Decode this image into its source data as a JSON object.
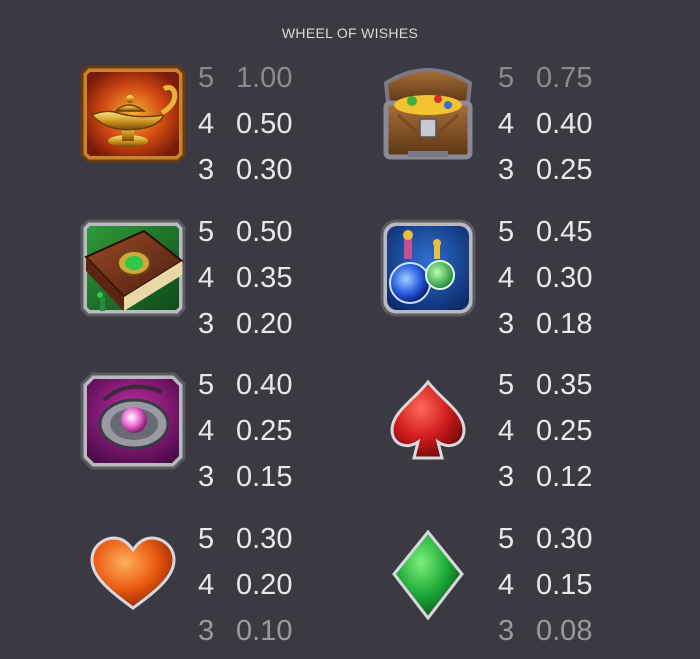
{
  "title": "WHEEL OF WISHES",
  "symbols": [
    {
      "name": "lamp-icon",
      "pays": [
        {
          "count": "5",
          "value": "1.00"
        },
        {
          "count": "4",
          "value": "0.50"
        },
        {
          "count": "3",
          "value": "0.30"
        }
      ]
    },
    {
      "name": "treasure-chest-icon",
      "pays": [
        {
          "count": "5",
          "value": "0.75"
        },
        {
          "count": "4",
          "value": "0.40"
        },
        {
          "count": "3",
          "value": "0.25"
        }
      ]
    },
    {
      "name": "spell-book-icon",
      "pays": [
        {
          "count": "5",
          "value": "0.50"
        },
        {
          "count": "4",
          "value": "0.35"
        },
        {
          "count": "3",
          "value": "0.20"
        }
      ]
    },
    {
      "name": "potion-icon",
      "pays": [
        {
          "count": "5",
          "value": "0.45"
        },
        {
          "count": "4",
          "value": "0.30"
        },
        {
          "count": "3",
          "value": "0.18"
        }
      ]
    },
    {
      "name": "amulet-icon",
      "pays": [
        {
          "count": "5",
          "value": "0.40"
        },
        {
          "count": "4",
          "value": "0.25"
        },
        {
          "count": "3",
          "value": "0.15"
        }
      ]
    },
    {
      "name": "spade-icon",
      "pays": [
        {
          "count": "5",
          "value": "0.35"
        },
        {
          "count": "4",
          "value": "0.25"
        },
        {
          "count": "3",
          "value": "0.12"
        }
      ]
    },
    {
      "name": "heart-icon",
      "pays": [
        {
          "count": "5",
          "value": "0.30"
        },
        {
          "count": "4",
          "value": "0.20"
        },
        {
          "count": "3",
          "value": "0.10"
        }
      ]
    },
    {
      "name": "diamond-icon",
      "pays": [
        {
          "count": "5",
          "value": "0.30"
        },
        {
          "count": "4",
          "value": "0.15"
        },
        {
          "count": "3",
          "value": "0.08"
        }
      ]
    }
  ]
}
